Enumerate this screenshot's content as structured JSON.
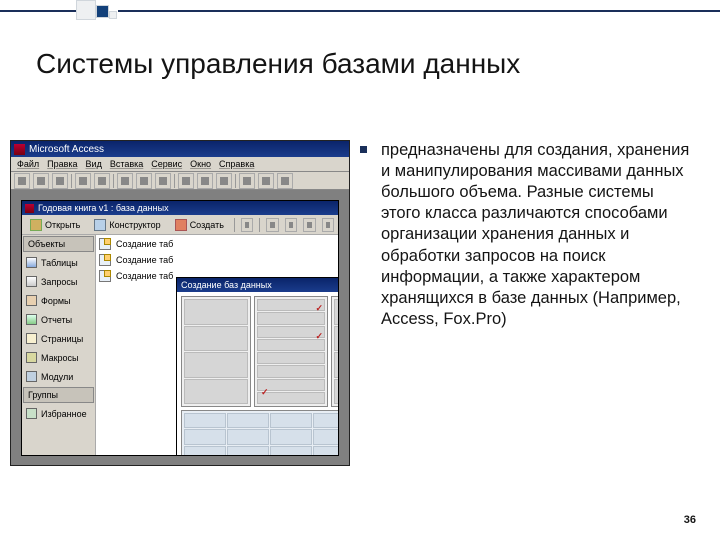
{
  "slide": {
    "title": "Системы управления базами данных",
    "body": "предназначены для создания, хранения и манипулирования массивами данных большого объема. Разные системы этого класса различаются способами организации хранения данных и обработки запросов на поиск информации, а также характером хранящихся в базе данных (Например, Access, Fox.Pro)",
    "page_number": "36"
  },
  "screenshot": {
    "app_title": "Microsoft Access",
    "menu": [
      "Файл",
      "Правка",
      "Вид",
      "Вставка",
      "Сервис",
      "Окно",
      "Справка"
    ],
    "db_window_title": "Годовая книга v1 : база данных",
    "db_tools": {
      "open": "Открыть",
      "design": "Конструктор",
      "create": "Создать"
    },
    "side_head_objects": "Объекты",
    "side_items": [
      "Таблицы",
      "Запросы",
      "Формы",
      "Отчеты",
      "Страницы",
      "Макросы",
      "Модули"
    ],
    "side_head_groups": "Группы",
    "side_groups": [
      "Избранное"
    ],
    "list_items": [
      "Создание таб",
      "Создание таб",
      "Создание таб"
    ],
    "popup_title": "Создание баз данных"
  }
}
